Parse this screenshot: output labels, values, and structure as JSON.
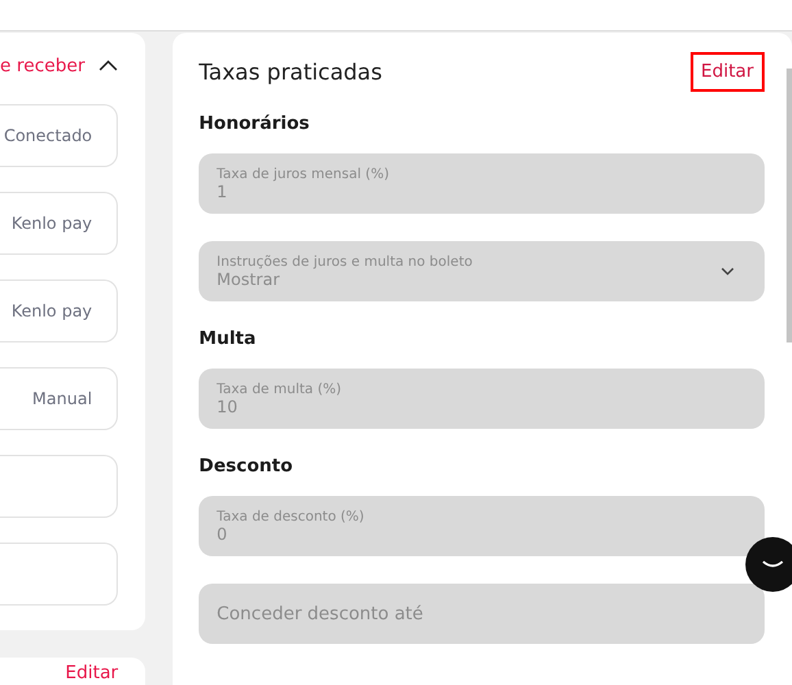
{
  "left_panel": {
    "title": "e receber",
    "expanded": true,
    "items": [
      {
        "kind": "status",
        "value": "Conectado"
      },
      {
        "kind": "status",
        "value": "Kenlo pay"
      },
      {
        "kind": "status",
        "value": "Kenlo pay"
      },
      {
        "kind": "status",
        "value": "Manual"
      },
      {
        "kind": "blank"
      },
      {
        "kind": "blank"
      }
    ]
  },
  "second_panel": {
    "action": "Editar"
  },
  "rates_panel": {
    "title": "Taxas praticadas",
    "action": "Editar",
    "sections": [
      {
        "title": "Honorários",
        "fields": [
          {
            "kind": "input",
            "label": "Taxa de juros mensal (%)",
            "value": "1",
            "disabled": true
          },
          {
            "kind": "select",
            "label": "Instruções de juros e multa no boleto",
            "value": "Mostrar",
            "disabled": true
          }
        ]
      },
      {
        "title": "Multa",
        "fields": [
          {
            "kind": "input",
            "label": "Taxa de multa (%)",
            "value": "10",
            "disabled": true
          }
        ]
      },
      {
        "title": "Desconto",
        "fields": [
          {
            "kind": "input",
            "label": "Taxa de desconto (%)",
            "value": "0",
            "disabled": true
          },
          {
            "kind": "input",
            "placeholder": "Conceder desconto até"
          }
        ]
      }
    ]
  }
}
